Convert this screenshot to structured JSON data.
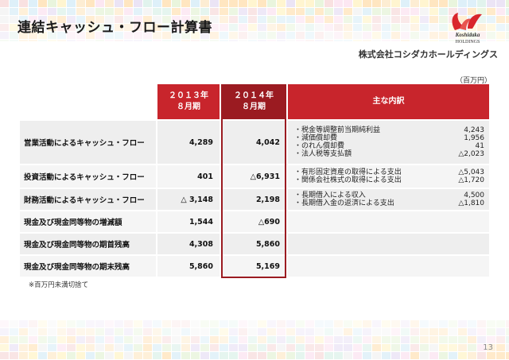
{
  "header": {
    "title": "連結キャッシュ・フロー計算書",
    "company": "株式会社コシダカホールディングス",
    "logo_text_1": "Koshidaka",
    "logo_text_2": "HOLDINGS"
  },
  "unit_label": "（百万円）",
  "columns": {
    "y2013_line1": "２０１３年",
    "y2013_line2": "８月期",
    "y2014_line1": "２０１４年",
    "y2014_line2": "８月期",
    "breakdown": "主な内訳"
  },
  "rows": [
    {
      "label": "営業活動によるキャッシュ・フロー",
      "v2013": "4,289",
      "v2014": "4,042",
      "details": [
        {
          "item": "・税金等調整前当期純利益",
          "value": "4,243"
        },
        {
          "item": "・減価償却費",
          "value": "1,956"
        },
        {
          "item": "・のれん償却費",
          "value": "41"
        },
        {
          "item": "・法人税等支払額",
          "value": "△2,023"
        }
      ]
    },
    {
      "label": "投資活動によるキャッシュ・フロー",
      "v2013": "401",
      "v2014": "△6,931",
      "details": [
        {
          "item": "・有形固定資産の取得による支出",
          "value": "△5,043"
        },
        {
          "item": "・関係会社株式の取得による支出",
          "value": "△1,720"
        }
      ]
    },
    {
      "label": "財務活動によるキャッシュ・フロー",
      "v2013": "△ 3,148",
      "v2014": "2,198",
      "details": [
        {
          "item": "・長期借入による収入",
          "value": "4,500"
        },
        {
          "item": "・長期借入金の返済による支出",
          "value": "△1,810"
        }
      ]
    },
    {
      "label": "現金及び現金同等物の増減額",
      "v2013": "1,544",
      "v2014": "△690",
      "details": []
    },
    {
      "label": "現金及び現金同等物の期首残高",
      "v2013": "4,308",
      "v2014": "5,860",
      "details": []
    },
    {
      "label": "現金及び現金同等物の期末残高",
      "v2013": "5,860",
      "v2014": "5,169",
      "details": []
    }
  ],
  "footnote": "※百万円未満切捨て",
  "page_number": "13",
  "colors": {
    "accent": "#c8252c",
    "accent_dark": "#9b1b21",
    "row_bg": "#eeeeee"
  }
}
